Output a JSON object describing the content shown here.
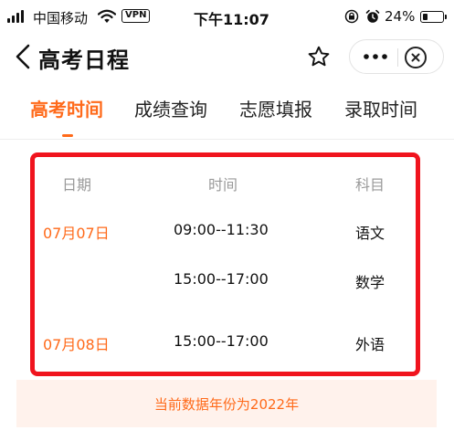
{
  "status_bar": {
    "carrier": "中国移动",
    "vpn": "VPN",
    "time": "下午11:07",
    "battery": "24%",
    "battery_level": 0.24
  },
  "nav": {
    "title": "高考日程"
  },
  "tabs": [
    {
      "label": "高考时间",
      "active": true
    },
    {
      "label": "成绩查询",
      "active": false
    },
    {
      "label": "志愿填报",
      "active": false
    },
    {
      "label": "录取时间",
      "active": false
    }
  ],
  "schedule": {
    "headers": {
      "date": "日期",
      "time": "时间",
      "subject": "科目"
    },
    "rows": [
      {
        "date": "07月07日",
        "time": "09:00--11:30",
        "subject": "语文"
      },
      {
        "date": "",
        "time": "15:00--17:00",
        "subject": "数学"
      },
      {
        "date": "07月08日",
        "time": "15:00--17:00",
        "subject": "外语"
      }
    ]
  },
  "note": "当前数据年份为2022年",
  "colors": {
    "accent": "#ff6a1a",
    "highlight_border": "#f0141e",
    "note_background": "#fff2ec"
  }
}
